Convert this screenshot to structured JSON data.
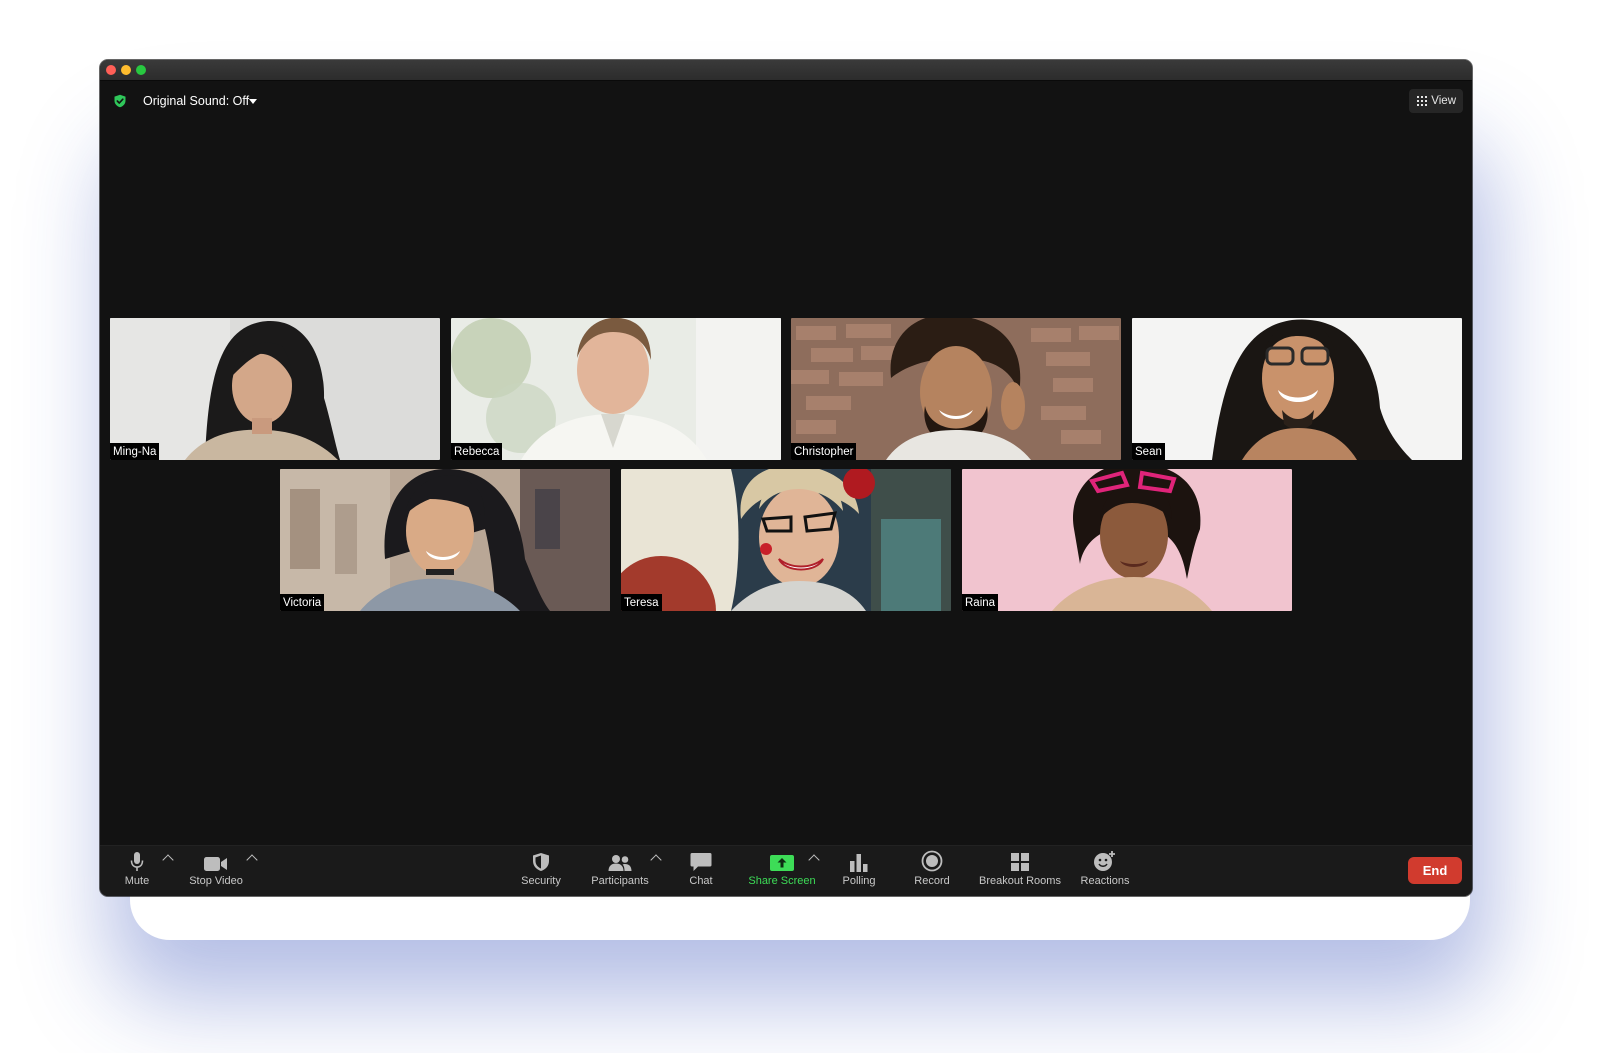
{
  "window": {
    "controls": [
      "close",
      "minimize",
      "zoom"
    ]
  },
  "topbar": {
    "encryption_icon": "shield-check-icon",
    "original_sound_label": "Original Sound: Off",
    "view_label": "View",
    "view_icon": "grid-icon"
  },
  "participants": [
    {
      "name": "Ming-Na"
    },
    {
      "name": "Rebecca"
    },
    {
      "name": "Christopher"
    },
    {
      "name": "Sean"
    },
    {
      "name": "Victoria"
    },
    {
      "name": "Teresa"
    },
    {
      "name": "Raina"
    }
  ],
  "toolbar": {
    "mute": {
      "label": "Mute",
      "icon": "microphone-icon"
    },
    "stop_video": {
      "label": "Stop Video",
      "icon": "video-camera-icon"
    },
    "security": {
      "label": "Security",
      "icon": "shield-icon"
    },
    "participants": {
      "label": "Participants",
      "icon": "people-icon"
    },
    "chat": {
      "label": "Chat",
      "icon": "chat-bubble-icon"
    },
    "share_screen": {
      "label": "Share Screen",
      "icon": "share-screen-icon",
      "color": "#3ddc57"
    },
    "polling": {
      "label": "Polling",
      "icon": "bar-chart-icon"
    },
    "record": {
      "label": "Record",
      "icon": "record-icon"
    },
    "breakout_rooms": {
      "label": "Breakout Rooms",
      "icon": "grid-squares-icon"
    },
    "reactions": {
      "label": "Reactions",
      "icon": "smiley-plus-icon"
    },
    "end": {
      "label": "End",
      "color": "#d13b2e"
    }
  }
}
